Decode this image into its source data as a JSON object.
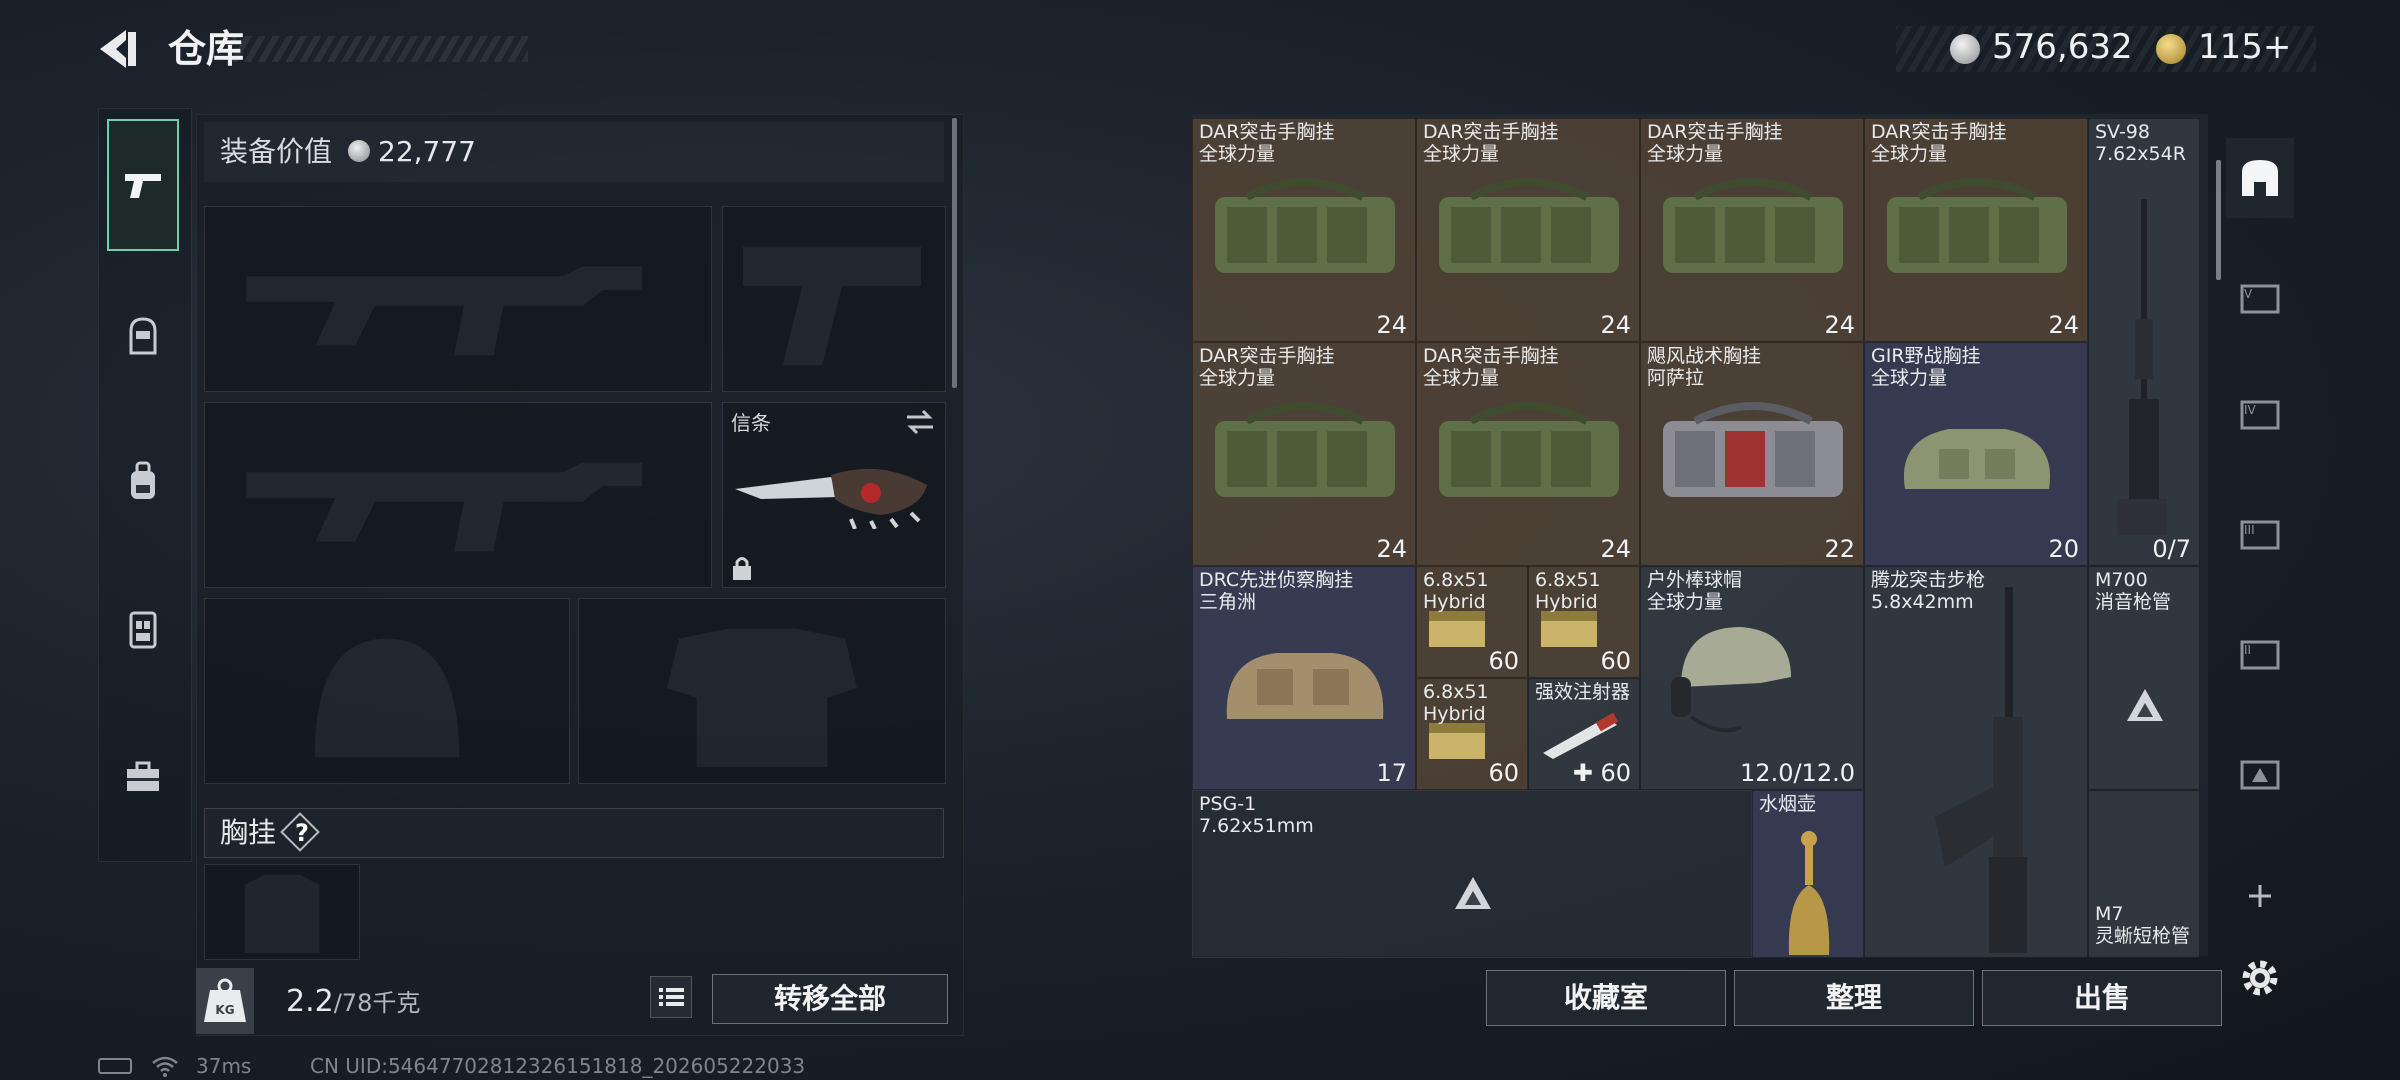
{
  "header": {
    "title": "仓库"
  },
  "currency": {
    "silver": "576,632",
    "gold": "115+",
    "gold_icon": "gold-coin-icon",
    "silver_icon": "silver-coin-icon"
  },
  "loadout": {
    "equipment_value_label": "装备价值",
    "equipment_value": "22,777",
    "melee_slot_name": "信条",
    "chest_rig_label": "胸挂",
    "chest_rig_help": "?",
    "weight_current": "2.2",
    "weight_max": "/78千克",
    "transfer_all_label": "转移全部"
  },
  "categories": [
    "weapon-icon",
    "helmet-icon",
    "backpack-icon",
    "chest-rig-icon",
    "toolbox-icon"
  ],
  "stash": {
    "items": [
      {
        "name1": "DAR突击手胸挂",
        "name2": "全球力量",
        "count": "24"
      },
      {
        "name1": "DAR突击手胸挂",
        "name2": "全球力量",
        "count": "24"
      },
      {
        "name1": "DAR突击手胸挂",
        "name2": "全球力量",
        "count": "24"
      },
      {
        "name1": "DAR突击手胸挂",
        "name2": "全球力量",
        "count": "24"
      },
      {
        "name1": "SV-98",
        "name2": "7.62x54R",
        "count": "0/7"
      },
      {
        "name1": "DAR突击手胸挂",
        "name2": "全球力量",
        "count": "24"
      },
      {
        "name1": "DAR突击手胸挂",
        "name2": "全球力量",
        "count": "24"
      },
      {
        "name1": "飓风战术胸挂",
        "name2": "阿萨拉",
        "count": "22"
      },
      {
        "name1": "GIR野战胸挂",
        "name2": "全球力量",
        "count": "20"
      },
      {
        "name1": "DRC先进侦察胸挂",
        "name2": "三角洲",
        "count": "17"
      },
      {
        "name1": "6.8x51",
        "name2": "Hybrid",
        "count": "60"
      },
      {
        "name1": "6.8x51",
        "name2": "Hybrid",
        "count": "60"
      },
      {
        "name1": "户外棒球帽",
        "name2": "全球力量",
        "count": "12.0/12.0"
      },
      {
        "name1": "腾龙突击步枪",
        "name2": "5.8x42mm",
        "count": ""
      },
      {
        "name1": "6.8x51",
        "name2": "Hybrid",
        "count": "60"
      },
      {
        "name1": "强效注射器",
        "name2": "",
        "count": "60"
      },
      {
        "name1": "M700",
        "name2": "消音枪管",
        "count": ""
      },
      {
        "name1": "PSG-1",
        "name2": "7.62x51mm",
        "count": ""
      },
      {
        "name1": "水烟壶",
        "name2": "",
        "count": ""
      },
      {
        "name1": "M7",
        "name2": "灵蜥短枪管",
        "count": ""
      }
    ]
  },
  "buttons": {
    "collection": "收藏室",
    "organize": "整理",
    "sell": "出售"
  },
  "status": {
    "ping": "37ms",
    "uid": "CN UID:5464770281232615181​8_202605222033"
  }
}
